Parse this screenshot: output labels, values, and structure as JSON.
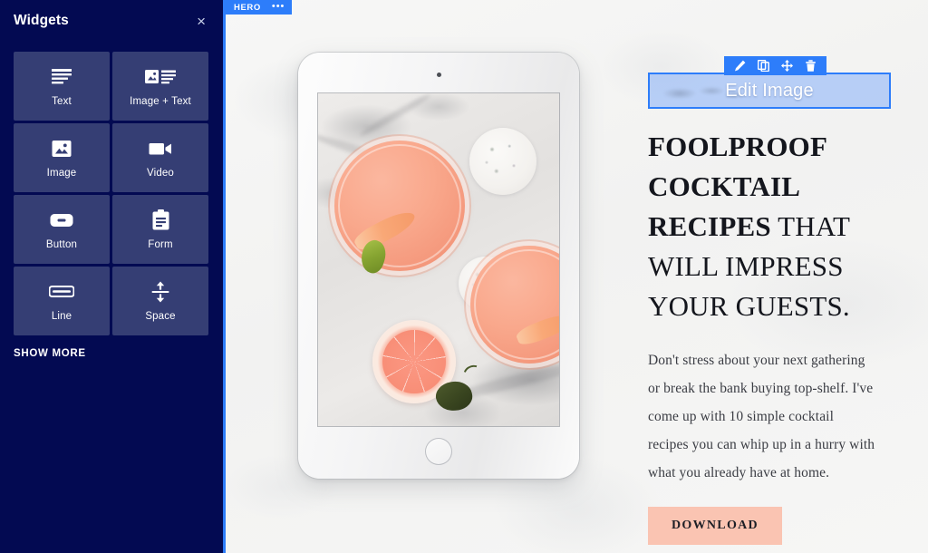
{
  "sidebar": {
    "title": "Widgets",
    "close_label": "×",
    "show_more_label": "SHOW MORE",
    "widgets": [
      {
        "label": "Text",
        "icon": "text-lines-icon"
      },
      {
        "label": "Image + Text",
        "icon": "image-text-icon"
      },
      {
        "label": "Image",
        "icon": "image-icon"
      },
      {
        "label": "Video",
        "icon": "video-camera-icon"
      },
      {
        "label": "Button",
        "icon": "button-icon"
      },
      {
        "label": "Form",
        "icon": "clipboard-form-icon"
      },
      {
        "label": "Line",
        "icon": "horizontal-line-icon"
      },
      {
        "label": "Space",
        "icon": "vertical-arrows-icon"
      }
    ]
  },
  "canvas": {
    "section_badge": {
      "label": "HERO",
      "menu_label": "•••"
    },
    "image_widget": {
      "label": "Edit Image",
      "toolbar": [
        {
          "name": "edit",
          "icon": "pencil-icon"
        },
        {
          "name": "duplicate",
          "icon": "copy-icon"
        },
        {
          "name": "move",
          "icon": "move-arrows-icon"
        },
        {
          "name": "delete",
          "icon": "trash-icon"
        }
      ]
    },
    "heading": {
      "strong": "FOOLPROOF COCKTAIL RECIPES",
      "light": " THAT WILL IMPRESS YOUR GUESTS."
    },
    "body": "Don't stress about your next gathering or break the bank buying top-shelf. I've come up with 10 simple cocktail recipes you can whip up in a hurry with what you already have at home.",
    "cta_label": "DOWNLOAD"
  },
  "colors": {
    "sidebar_bg": "#030a52",
    "tile_bg": "#353e74",
    "accent_blue": "#2d7dfa",
    "selection_fill": "rgba(123,170,250,0.50)",
    "cta_bg": "#fac4b2",
    "canvas_bg": "#f3f3f2",
    "heading_text": "#14161d",
    "body_text": "#3b3d44"
  }
}
